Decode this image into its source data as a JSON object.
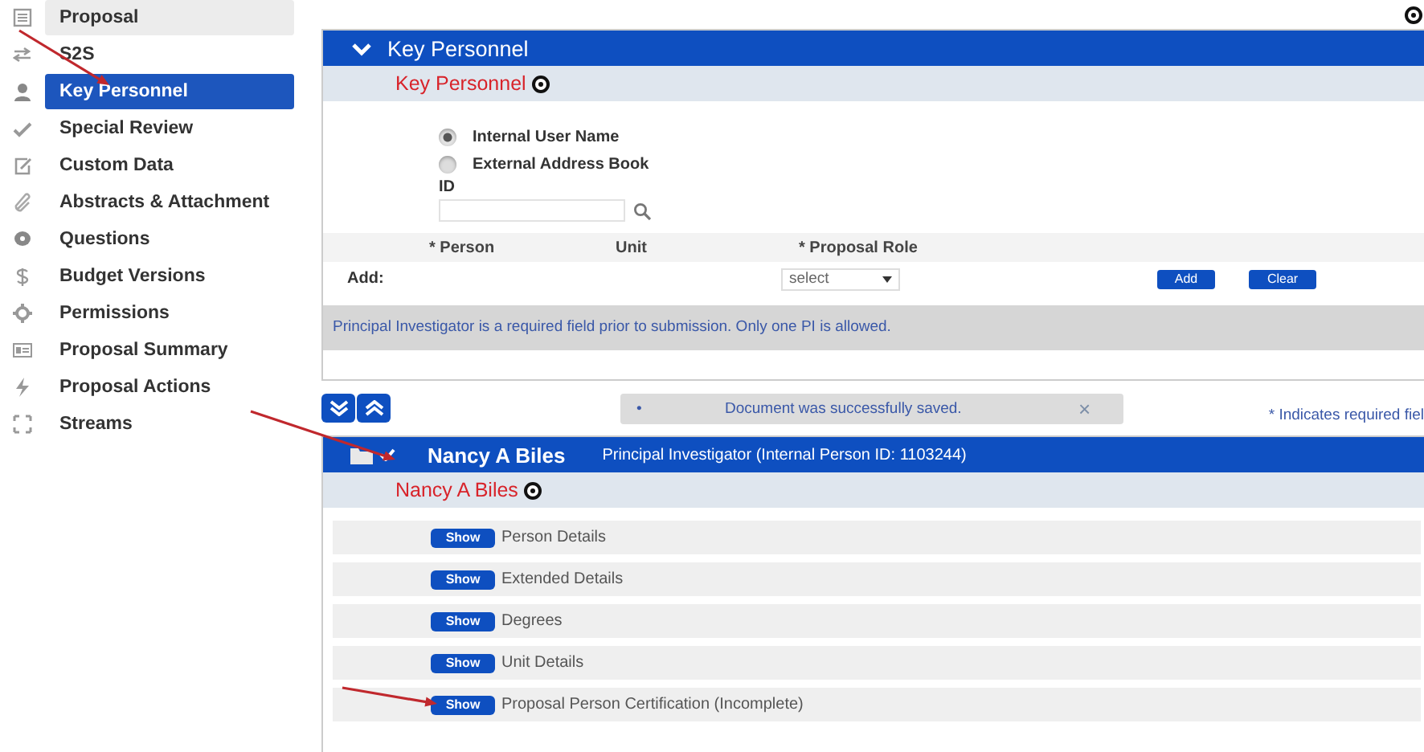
{
  "sidebar": {
    "items": [
      {
        "label": "Proposal",
        "selected": false,
        "highlighted": true
      },
      {
        "label": "S2S",
        "selected": false,
        "highlighted": false
      },
      {
        "label": "Key Personnel",
        "selected": true,
        "highlighted": false
      },
      {
        "label": "Special Review",
        "selected": false,
        "highlighted": false
      },
      {
        "label": "Custom Data",
        "selected": false,
        "highlighted": false
      },
      {
        "label": "Abstracts & Attachment",
        "selected": false,
        "highlighted": false
      },
      {
        "label": "Questions",
        "selected": false,
        "highlighted": false
      },
      {
        "label": "Budget Versions",
        "selected": false,
        "highlighted": false
      },
      {
        "label": "Permissions",
        "selected": false,
        "highlighted": false
      },
      {
        "label": "Proposal Summary",
        "selected": false,
        "highlighted": false
      },
      {
        "label": "Proposal Actions",
        "selected": false,
        "highlighted": false
      },
      {
        "label": "Streams",
        "selected": false,
        "highlighted": false
      }
    ]
  },
  "key_personnel": {
    "title": "Key Personnel",
    "subtitle": "Key Personnel",
    "expanded": true,
    "radios": [
      {
        "label": "Internal User Name",
        "selected": true
      },
      {
        "label": "External Address Book",
        "selected": false
      }
    ],
    "id_label": "ID",
    "columns": [
      "* Person",
      "Unit",
      "* Proposal Role"
    ],
    "add_label": "Add:",
    "role_select": "select",
    "buttons": [
      "Add",
      "Clear"
    ],
    "info": "Principal Investigator is a required field prior to submission. Only one PI is allowed."
  },
  "message": "Document was successfully saved.",
  "message_bullet": "•",
  "message_close": "×",
  "required_note": "* Indicates required fiel",
  "person": {
    "name": "Nancy A Biles",
    "role": "Principal Investigator (Internal Person ID: 1103244)",
    "subtitle": "Nancy A Biles",
    "sections": [
      {
        "button": "Show",
        "label": "Person Details"
      },
      {
        "button": "Show",
        "label": "Extended Details"
      },
      {
        "button": "Show",
        "label": "Degrees"
      },
      {
        "button": "Show",
        "label": "Unit Details"
      },
      {
        "button": "Show",
        "label": "Proposal Person Certification (Incomplete)"
      }
    ]
  }
}
